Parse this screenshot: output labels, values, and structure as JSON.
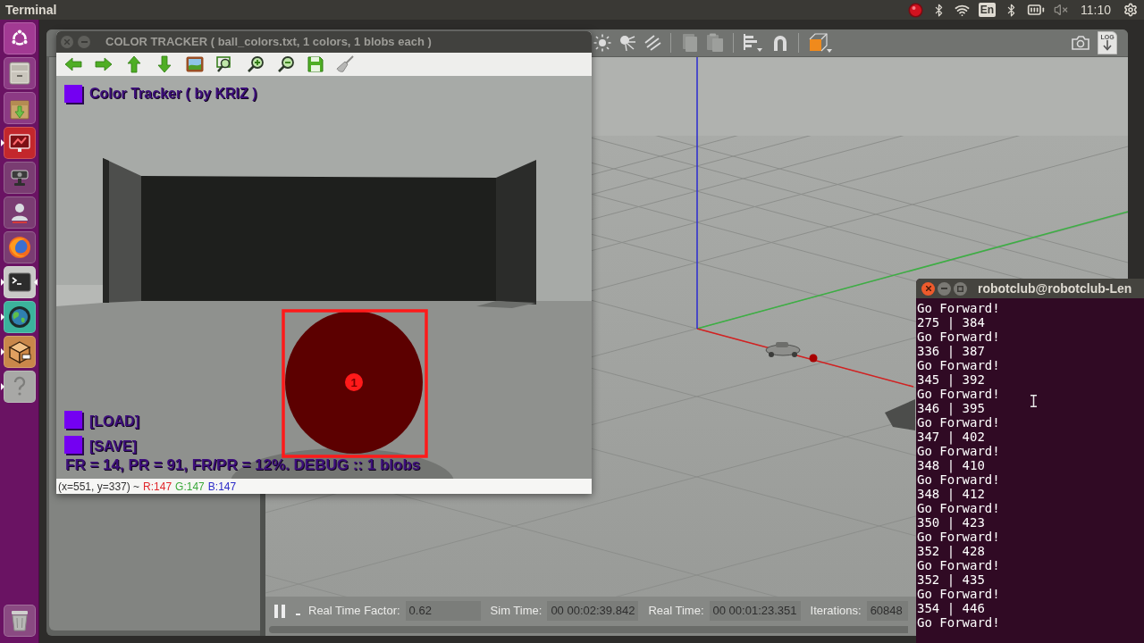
{
  "top_panel": {
    "title": "Terminal",
    "keyboard_layout": "En",
    "clock": "11:10"
  },
  "launcher": {
    "items": [
      {
        "running": false,
        "focused": false
      },
      {
        "running": false,
        "focused": false
      },
      {
        "running": false,
        "focused": false
      },
      {
        "running": true,
        "focused": false
      },
      {
        "running": false,
        "focused": false
      },
      {
        "running": false,
        "focused": false
      },
      {
        "running": false,
        "focused": false
      },
      {
        "running": true,
        "focused": true
      },
      {
        "running": true,
        "focused": false
      },
      {
        "running": true,
        "focused": false
      },
      {
        "running": true,
        "focused": false
      }
    ]
  },
  "color_tracker": {
    "title": "COLOR TRACKER ( ball_colors.txt, 1 colors, 1 blobs each )",
    "overlay": {
      "heading": "Color Tracker ( by KRIZ )",
      "buttons": [
        "[LOAD]",
        "[SAVE]"
      ],
      "stats": "FR = 14, PR = 91, FR/PR = 12%. DEBUG :: 1 blobs",
      "blob_label": "1"
    },
    "status": {
      "position": "(x=551, y=337) ~",
      "channels": [
        {
          "label": "R:147",
          "color": "#e0262b"
        },
        {
          "label": "G:147",
          "color": "#3aa83a"
        },
        {
          "label": "B:147",
          "color": "#2b2bc8"
        }
      ]
    }
  },
  "gazebo": {
    "toolbar": {
      "log_label": "LOG"
    },
    "status_bar": {
      "fields": [
        {
          "label": "Real Time Factor:",
          "value": "0.62"
        },
        {
          "label": "Sim Time:",
          "value": "00 00:02:39.842"
        },
        {
          "label": "Real Time:",
          "value": "00 00:01:23.351"
        },
        {
          "label": "Iterations:",
          "value": "60848"
        }
      ]
    }
  },
  "terminal": {
    "title": "robotclub@robotclub-Len",
    "lines": [
      "Go Forward!",
      "275 | 384",
      "Go Forward!",
      "336 | 387",
      "Go Forward!",
      "345 | 392",
      "Go Forward!",
      "346 | 395",
      "Go Forward!",
      "347 | 402",
      "Go Forward!",
      "348 | 410",
      "Go Forward!",
      "348 | 412",
      "Go Forward!",
      "350 | 423",
      "Go Forward!",
      "352 | 428",
      "Go Forward!",
      "352 | 435",
      "Go Forward!",
      "354 | 446",
      "Go Forward!"
    ]
  }
}
